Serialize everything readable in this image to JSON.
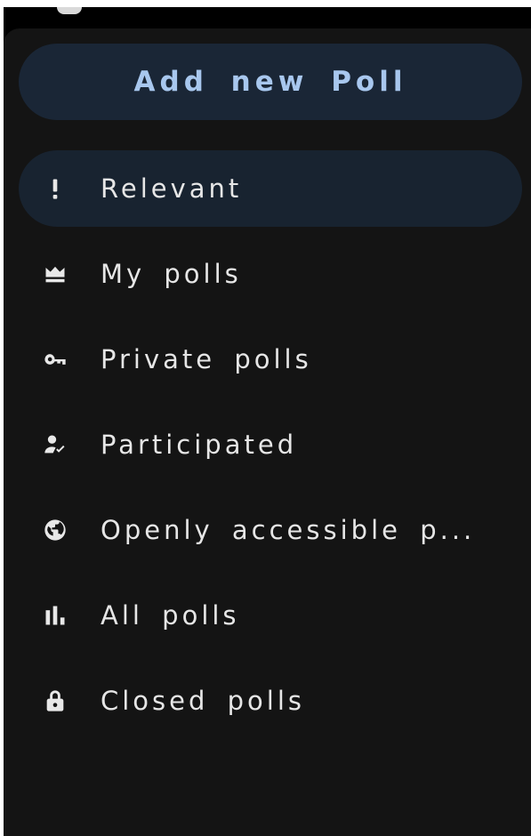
{
  "drawer": {
    "add_button_label": "Add new Poll",
    "active_index": 0,
    "items": [
      {
        "label": "Relevant",
        "icon": "exclamation-icon"
      },
      {
        "label": "My polls",
        "icon": "crown-icon"
      },
      {
        "label": "Private polls",
        "icon": "key-icon"
      },
      {
        "label": "Participated",
        "icon": "person-check-icon"
      },
      {
        "label": "Openly accessible p...",
        "icon": "globe-icon"
      },
      {
        "label": "All polls",
        "icon": "bar-chart-icon"
      },
      {
        "label": "Closed polls",
        "icon": "lock-icon"
      }
    ]
  },
  "colors": {
    "accent_text": "#a8c7ee",
    "button_bg": "#1a2636",
    "active_bg": "#182330",
    "drawer_bg": "#141414"
  }
}
